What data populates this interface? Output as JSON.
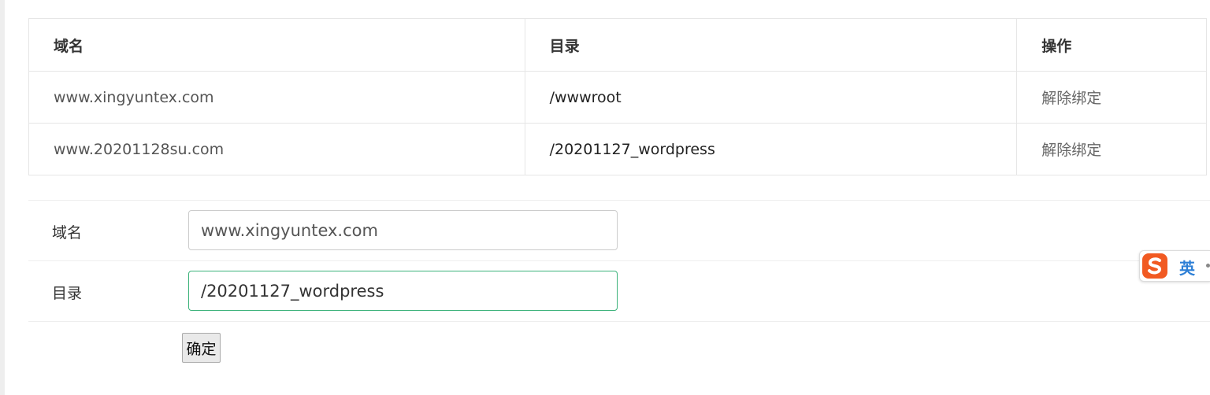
{
  "table": {
    "headers": {
      "domain": "域名",
      "directory": "目录",
      "action": "操作"
    },
    "rows": [
      {
        "domain": "www.xingyuntex.com",
        "directory": "/wwwroot",
        "action": "解除绑定"
      },
      {
        "domain": "www.20201128su.com",
        "directory": "/20201127_wordpress",
        "action": "解除绑定"
      }
    ]
  },
  "form": {
    "domain_label": "域名",
    "domain_value": "www.xingyuntex.com",
    "directory_label": "目录",
    "directory_value": "/20201127_wordpress",
    "submit_label": "确定"
  },
  "ime": {
    "logo_icon": "sogou-s-icon",
    "lang": "英"
  },
  "colors": {
    "focus_border": "#3bb27a",
    "ime_logo": "#f15a22",
    "ime_lang": "#2d7fd6"
  }
}
